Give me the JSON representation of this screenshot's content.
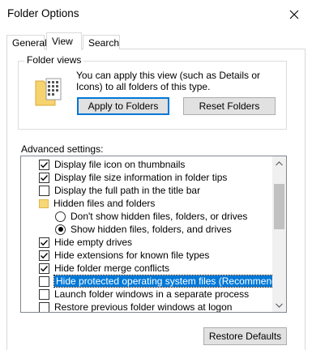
{
  "window": {
    "title": "Folder Options"
  },
  "tabs": [
    {
      "label": "General"
    },
    {
      "label": "View"
    },
    {
      "label": "Search"
    }
  ],
  "folder_views": {
    "legend": "Folder views",
    "description": "You can apply this view (such as Details or Icons) to all folders of this type.",
    "apply_button": "Apply to Folders",
    "reset_button": "Reset Folders"
  },
  "advanced": {
    "label": "Advanced settings:",
    "items": [
      {
        "label": "Display file icon on thumbnails",
        "kind": "checkbox",
        "checked": true
      },
      {
        "label": "Display file size information in folder tips",
        "kind": "checkbox",
        "checked": true
      },
      {
        "label": "Display the full path in the title bar",
        "kind": "checkbox",
        "checked": false
      },
      {
        "label": "Hidden files and folders",
        "kind": "folder"
      },
      {
        "label": "Don't show hidden files, folders, or drives",
        "kind": "radio",
        "checked": false
      },
      {
        "label": "Show hidden files, folders, and drives",
        "kind": "radio",
        "checked": true
      },
      {
        "label": "Hide empty drives",
        "kind": "checkbox",
        "checked": true
      },
      {
        "label": "Hide extensions for known file types",
        "kind": "checkbox",
        "checked": true
      },
      {
        "label": "Hide folder merge conflicts",
        "kind": "checkbox",
        "checked": true
      },
      {
        "label": "Hide protected operating system files (Recommended)",
        "kind": "checkbox",
        "checked": false,
        "selected": true
      },
      {
        "label": "Launch folder windows in a separate process",
        "kind": "checkbox",
        "checked": false
      },
      {
        "label": "Restore previous folder windows at logon",
        "kind": "checkbox",
        "checked": false
      }
    ]
  },
  "restore_button": "Restore Defaults"
}
